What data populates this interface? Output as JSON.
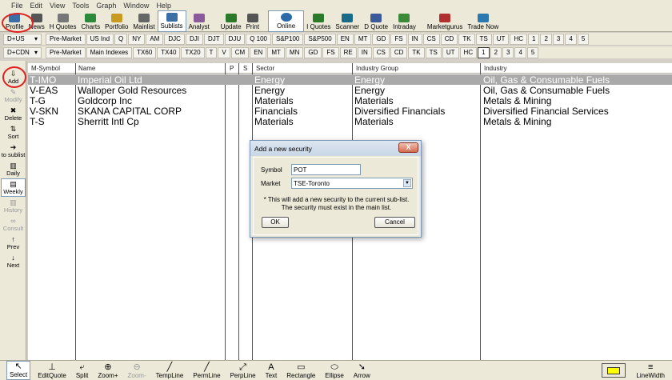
{
  "menu": [
    "File",
    "Edit",
    "View",
    "Tools",
    "Graph",
    "Window",
    "Help"
  ],
  "toolbar": [
    {
      "label": "Profile",
      "icon": "profile-icon"
    },
    {
      "label": "News",
      "icon": "news-icon"
    },
    {
      "label": "H Quotes",
      "icon": "history-quotes-icon"
    },
    {
      "label": "Charts",
      "icon": "charts-icon"
    },
    {
      "label": "Portfolio",
      "icon": "portfolio-icon"
    },
    {
      "label": "Mainlist",
      "icon": "mainlist-icon"
    },
    {
      "label": "Sublists",
      "icon": "sublists-icon"
    },
    {
      "label": "Analyst",
      "icon": "analyst-icon"
    },
    {
      "label": "Update",
      "icon": "update-icon"
    },
    {
      "label": "Print",
      "icon": "print-icon"
    },
    {
      "label": "Online",
      "icon": "online-icon"
    },
    {
      "label": "I Quotes",
      "icon": "intraday-quotes-icon"
    },
    {
      "label": "Scanner",
      "icon": "scanner-icon"
    },
    {
      "label": "D Quote",
      "icon": "d-quote-icon"
    },
    {
      "label": "Intraday",
      "icon": "intraday-icon"
    },
    {
      "label": "Marketgurus",
      "icon": "marketgurus-icon"
    },
    {
      "label": "Trade Now",
      "icon": "trade-now-icon"
    }
  ],
  "us_row": {
    "dropdown": "D+US",
    "items": [
      "Pre-Market",
      "US Ind",
      "Q",
      "NY",
      "AM",
      "DJC",
      "DJI",
      "DJT",
      "DJU",
      "Q 100",
      "S&P100",
      "S&P500",
      "EN",
      "MT",
      "GD",
      "FS",
      "IN",
      "CS",
      "CD",
      "TK",
      "TS",
      "UT",
      "HC",
      "1",
      "2",
      "3",
      "4",
      "5"
    ]
  },
  "cdn_row": {
    "dropdown": "D+CDN",
    "items": [
      "Pre-Market",
      "Main Indexes",
      "TX60",
      "TX40",
      "TX20",
      "T",
      "V",
      "CM",
      "EN",
      "MT",
      "MN",
      "GD",
      "FS",
      "RE",
      "IN",
      "CS",
      "CD",
      "TK",
      "TS",
      "UT",
      "HC",
      "1",
      "2",
      "3",
      "4",
      "5"
    ],
    "selected": "1"
  },
  "sidebar": [
    {
      "label": "Add",
      "glyph": "⇩"
    },
    {
      "label": "Modify",
      "glyph": "✎"
    },
    {
      "label": "Delete",
      "glyph": "✖"
    },
    {
      "label": "Sort",
      "glyph": "⇅"
    },
    {
      "label": "to sublist",
      "glyph": "➔"
    },
    {
      "label": "Daily",
      "glyph": "▥"
    },
    {
      "label": "Weekly",
      "glyph": "▤"
    },
    {
      "label": "History",
      "glyph": "▥"
    },
    {
      "label": "Consult",
      "glyph": "∞"
    },
    {
      "label": "Prev",
      "glyph": "↑"
    },
    {
      "label": "Next",
      "glyph": "↓"
    }
  ],
  "grid": {
    "headers": [
      "M-Symbol",
      "Name",
      "P",
      "S",
      "Sector",
      "Industry Group",
      "Industry"
    ],
    "rows": [
      {
        "symbol": "T-IMO",
        "name": "Imperial Oil Ltd",
        "sector": "Energy",
        "group": "Energy",
        "industry": "Oil, Gas & Consumable Fuels",
        "selected": true
      },
      {
        "symbol": "V-EAS",
        "name": "Walloper Gold Resources",
        "sector": "Energy",
        "group": "Energy",
        "industry": "Oil, Gas & Consumable Fuels"
      },
      {
        "symbol": "T-G",
        "name": "Goldcorp Inc",
        "sector": "Materials",
        "group": "Materials",
        "industry": "Metals & Mining"
      },
      {
        "symbol": "V-SKN",
        "name": "SKANA CAPITAL CORP",
        "sector": "Financials",
        "group": "Diversified Financials",
        "industry": "Diversified Financial Services"
      },
      {
        "symbol": "T-S",
        "name": "Sherritt Intl Cp",
        "sector": "Materials",
        "group": "Materials",
        "industry": "Metals & Mining"
      }
    ]
  },
  "dialog": {
    "title": "Add a new security",
    "close": "X",
    "symbol_label": "Symbol",
    "symbol_value": "POT",
    "market_label": "Market",
    "market_value": "TSE-Toronto",
    "note1": "* This will add a new security to the current sub-list.",
    "note2": "The security must exist in the main list.",
    "ok": "OK",
    "cancel": "Cancel"
  },
  "statusbar": [
    {
      "label": "Select",
      "glyph": "↖"
    },
    {
      "label": "EditQuote",
      "glyph": "⊥"
    },
    {
      "label": "Split",
      "glyph": "⤶"
    },
    {
      "label": "Zoom+",
      "glyph": "⊕"
    },
    {
      "label": "Zoom-",
      "glyph": "⊖"
    },
    {
      "label": "TempLine",
      "glyph": "╱"
    },
    {
      "label": "PermLine",
      "glyph": "╱"
    },
    {
      "label": "PerpLine",
      "glyph": "⤢"
    },
    {
      "label": "Text",
      "glyph": "A"
    },
    {
      "label": "Rectangle",
      "glyph": "▭"
    },
    {
      "label": "Ellipse",
      "glyph": "⬭"
    },
    {
      "label": "Arrow",
      "glyph": "➘"
    },
    {
      "label": "LineWidth",
      "glyph": "≡"
    }
  ],
  "colors": {
    "selection": "#a9a9a9",
    "swatch": "#ffff00",
    "highlight": "#e02020"
  }
}
